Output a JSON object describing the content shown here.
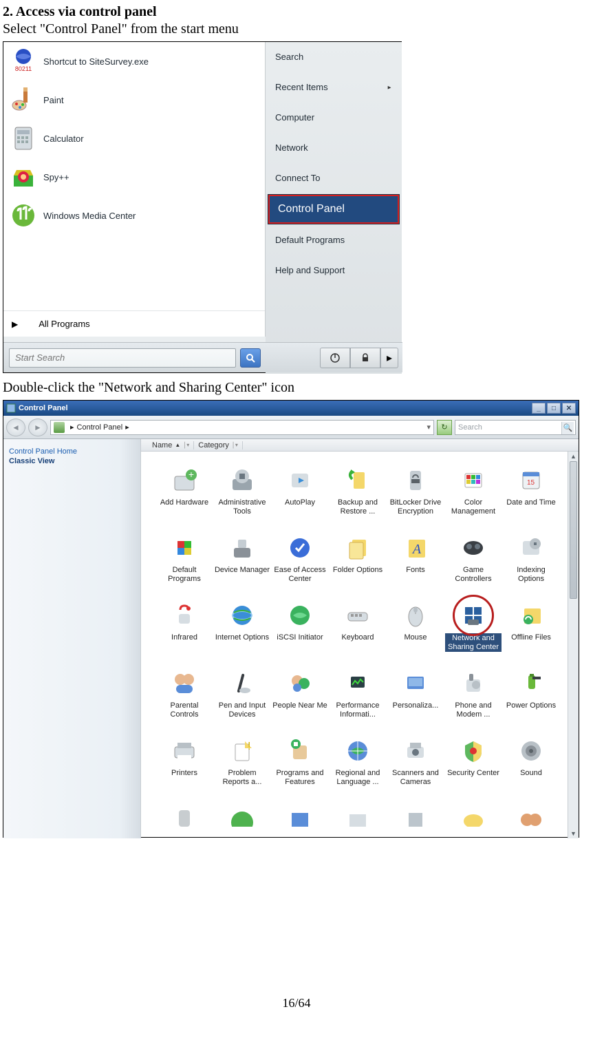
{
  "doc": {
    "heading": "2. Access via control panel",
    "instruction1": "Select \"Control Panel\" from the start menu",
    "instruction2": "Double-click the \"Network and Sharing Center\" icon",
    "page_number": "16/64"
  },
  "startmenu": {
    "left_items": [
      {
        "label": "Shortcut to SiteSurvey.exe",
        "icon": "sitesurvey"
      },
      {
        "label": "Paint",
        "icon": "paint"
      },
      {
        "label": "Calculator",
        "icon": "calculator"
      },
      {
        "label": "Spy++",
        "icon": "spy"
      },
      {
        "label": "Windows Media Center",
        "icon": "wmc"
      }
    ],
    "all_programs": "All Programs",
    "right_items": [
      {
        "label": "Search"
      },
      {
        "label": "Recent Items",
        "submenu": true
      },
      {
        "label": "Computer"
      },
      {
        "label": "Network"
      },
      {
        "label": "Connect To"
      },
      {
        "label": "Control Panel",
        "highlighted": true
      },
      {
        "label": "Default Programs"
      },
      {
        "label": "Help and Support"
      }
    ],
    "search_placeholder": "Start Search"
  },
  "controlpanel": {
    "title": "Control Panel",
    "breadcrumb": "Control Panel",
    "search_placeholder": "Search",
    "sort_columns": [
      "Name",
      "Category"
    ],
    "sidebar": {
      "home": "Control Panel Home",
      "classic": "Classic View"
    },
    "items": [
      "Add Hardware",
      "Administrative Tools",
      "AutoPlay",
      "Backup and Restore ...",
      "BitLocker Drive Encryption",
      "Color Management",
      "Date and Time",
      "Default Programs",
      "Device Manager",
      "Ease of Access Center",
      "Folder Options",
      "Fonts",
      "Game Controllers",
      "Indexing Options",
      "Infrared",
      "Internet Options",
      "iSCSI Initiator",
      "Keyboard",
      "Mouse",
      "Network and Sharing Center",
      "Offline Files",
      "Parental Controls",
      "Pen and Input Devices",
      "People Near Me",
      "Performance Informati...",
      "Personaliza...",
      "Phone and Modem ...",
      "Power Options",
      "Printers",
      "Problem Reports a...",
      "Programs and Features",
      "Regional and Language ...",
      "Scanners and Cameras",
      "Security Center",
      "Sound"
    ],
    "highlighted_index": 19
  }
}
